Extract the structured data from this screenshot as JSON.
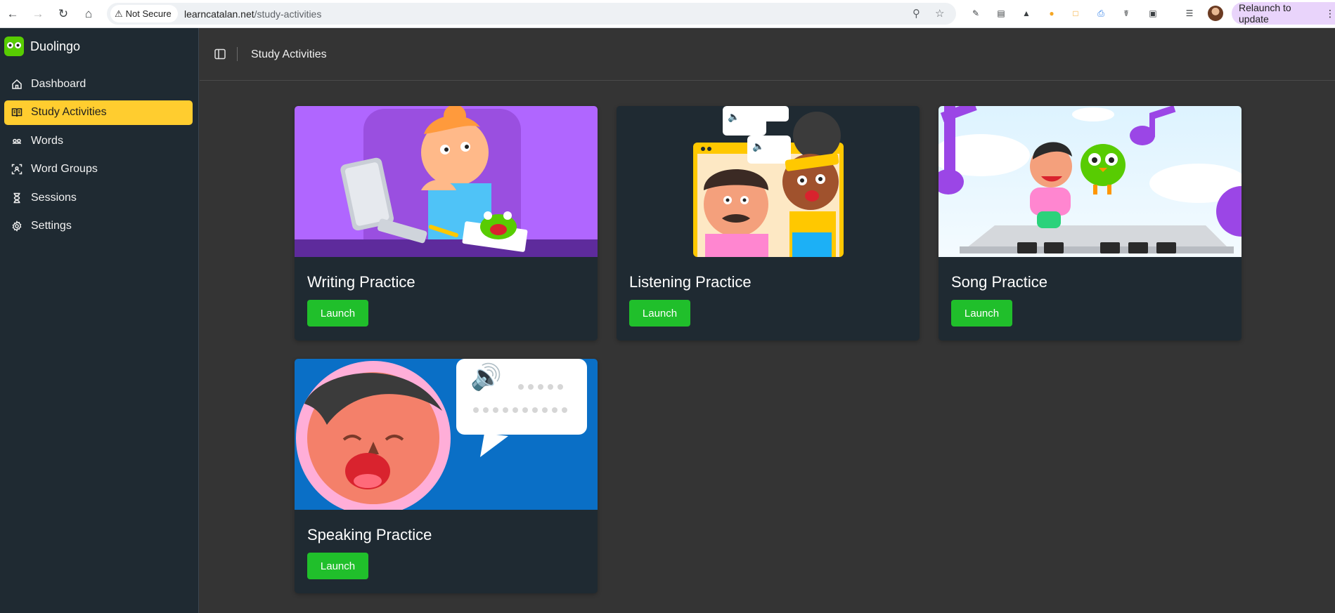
{
  "browser": {
    "security_label": "Not Secure",
    "url_host": "learncatalan.net",
    "url_path": "/study-activities",
    "relaunch_label": "Relaunch to update"
  },
  "sidebar": {
    "brand": "Duolingo",
    "items": [
      {
        "label": "Dashboard",
        "icon": "home-icon"
      },
      {
        "label": "Study Activities",
        "icon": "book-open-icon"
      },
      {
        "label": "Words",
        "icon": "words-icon"
      },
      {
        "label": "Word Groups",
        "icon": "group-scan-icon"
      },
      {
        "label": "Sessions",
        "icon": "hourglass-icon"
      },
      {
        "label": "Settings",
        "icon": "gear-icon"
      }
    ]
  },
  "header": {
    "breadcrumb": "Study Activities"
  },
  "activities": [
    {
      "title": "Writing Practice",
      "button": "Launch"
    },
    {
      "title": "Listening Practice",
      "button": "Launch"
    },
    {
      "title": "Song Practice",
      "button": "Launch"
    },
    {
      "title": "Speaking Practice",
      "button": "Launch"
    }
  ],
  "colors": {
    "accent": "#ffcd2f",
    "launch": "#20bf2b",
    "sidebar_bg": "#1f2a32",
    "main_bg": "#343434"
  }
}
